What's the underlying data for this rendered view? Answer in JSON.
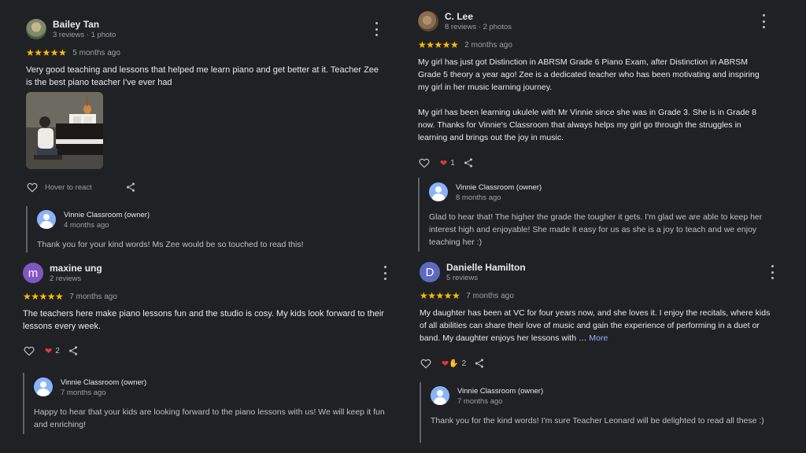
{
  "reviews": [
    {
      "name": "Bailey Tan",
      "meta": "3 reviews · 1 photo",
      "stars": "★★★★★",
      "ago": "5 months ago",
      "text": [
        "Very good teaching and lessons that helped me learn piano and get better at it. Teacher Zee is the best piano teacher I've ever had"
      ],
      "hover_label": "Hover to react",
      "owner": {
        "name": "Vinnie Classroom (owner)",
        "ago": "4 months ago",
        "text": "Thank you for your kind words! Ms Zee would be so touched to read this!"
      }
    },
    {
      "name": "maxine ung",
      "avatar_letter": "m",
      "meta": "2 reviews",
      "stars": "★★★★★",
      "ago": "7 months ago",
      "text": [
        "The teachers here make piano lessons fun and the studio is cosy. My kids look forward to their lessons every week."
      ],
      "reactions": "2",
      "owner": {
        "name": "Vinnie Classroom (owner)",
        "ago": "7 months ago",
        "text": "Happy to hear that your kids are looking forward to the piano lessons with us! We will keep it fun and enriching!"
      }
    },
    {
      "name": "C. Lee",
      "meta": "8 reviews · 2 photos",
      "stars": "★★★★★",
      "ago": "2 months ago",
      "text": [
        "My girl has just got Distinction in ABRSM Grade 6 Piano Exam, after Distinction in ABRSM Grade 5 theory a year ago! Zee is a dedicated teacher who has been motivating and inspiring my girl in her music learning journey.",
        "My girl has been learning ukulele with Mr Vinnie since she was in Grade 3. She is in Grade 8 now. Thanks for Vinnie's Classroom that always helps my girl go through the struggles in learning and brings out the joy in music."
      ],
      "reactions": "1",
      "owner": {
        "name": "Vinnie Classroom (owner)",
        "ago": "8 months ago",
        "text": "Glad to hear that! The higher the grade the tougher it gets. I'm glad we are able to keep her interest high and enjoyable! She made it easy for us as she is a joy to teach and we enjoy teaching her :)"
      }
    },
    {
      "name": "Danielle Hamilton",
      "avatar_letter": "D",
      "meta": "5 reviews",
      "stars": "★★★★★",
      "ago": "7 months ago",
      "text_truncated": "My daughter has been at VC for four years now, and she loves it. I enjoy the recitals, where kids of all abilities can share their love of music and gain the experience of performing in a duet or band. My daughter enjoys her lessons with …",
      "more_label": "More",
      "reactions": "2",
      "owner": {
        "name": "Vinnie Classroom (owner)",
        "ago": "7 months ago",
        "text": "Thank you for the kind words! I'm sure Teacher Leonard will be delighted to read all these :)"
      }
    }
  ],
  "colors": {
    "background": "#202124",
    "star": "#fbbc04",
    "link": "#8ab4f8",
    "avatar_maxine": "#7e57c2",
    "avatar_danielle": "#5c6bc0",
    "heart": "#e53935"
  },
  "icons": [
    "heart-outline-icon",
    "share-icon",
    "more-vert-icon",
    "heart-icon",
    "praying-hands-icon",
    "owner-avatar-icon"
  ]
}
